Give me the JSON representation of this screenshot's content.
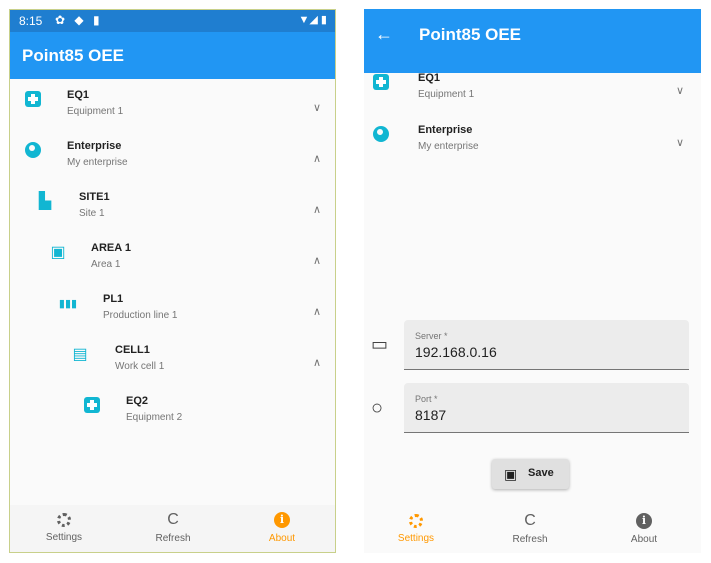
{
  "colors": {
    "primary": "#2196f3",
    "status_bar": "#1f7ed0",
    "icon_teal": "#11b6d2",
    "active_nav": "#ff9800"
  },
  "left": {
    "status": {
      "time": "8:15",
      "icons": "✿ ◆ ▮",
      "right_icons": "▼◢ ▮"
    },
    "app_title": "Point85 OEE",
    "tree": [
      {
        "icon": "equipment-icon",
        "name": "EQ1",
        "desc": "Equipment 1",
        "chevron": "∨"
      },
      {
        "icon": "globe-icon",
        "name": "Enterprise",
        "desc": "My enterprise",
        "chevron": "∧"
      },
      {
        "icon": "site-icon",
        "glyph": "▙",
        "name": "SITE1",
        "desc": "Site 1",
        "chevron": "∧"
      },
      {
        "icon": "area-icon",
        "glyph": "▣",
        "name": "AREA 1",
        "desc": "Area 1",
        "chevron": "∧"
      },
      {
        "icon": "production-line-icon",
        "glyph": "▮▮▮",
        "name": "PL1",
        "desc": "Production line 1",
        "chevron": "∧"
      },
      {
        "icon": "work-cell-icon",
        "glyph": "▤",
        "name": "CELL1",
        "desc": "Work cell 1",
        "chevron": "∧"
      },
      {
        "icon": "equipment-icon",
        "name": "EQ2",
        "desc": "Equipment 2"
      }
    ],
    "nav": [
      {
        "label": "Settings",
        "icon": "gear-icon"
      },
      {
        "label": "Refresh",
        "icon": "refresh-icon",
        "glyph": "C"
      },
      {
        "label": "About",
        "icon": "info-icon"
      }
    ]
  },
  "right": {
    "back_glyph": "←",
    "app_title": "Point85 OEE",
    "tree": [
      {
        "icon": "equipment-icon",
        "name": "EQ1",
        "desc": "Equipment 1",
        "chevron": "∨"
      },
      {
        "icon": "globe-icon",
        "name": "Enterprise",
        "desc": "My enterprise",
        "chevron": "∨"
      }
    ],
    "server": {
      "label": "Server *",
      "value": "192.168.0.16",
      "icon": "computer-icon",
      "glyph": "▭"
    },
    "port": {
      "label": "Port *",
      "value": "8187",
      "icon": "circle-icon",
      "glyph": "○"
    },
    "save": {
      "label": "Save",
      "icon": "save-icon",
      "glyph": "▣"
    },
    "nav": [
      {
        "label": "Settings",
        "icon": "gear-icon"
      },
      {
        "label": "Refresh",
        "icon": "refresh-icon",
        "glyph": "C"
      },
      {
        "label": "About",
        "icon": "info-icon"
      }
    ]
  }
}
